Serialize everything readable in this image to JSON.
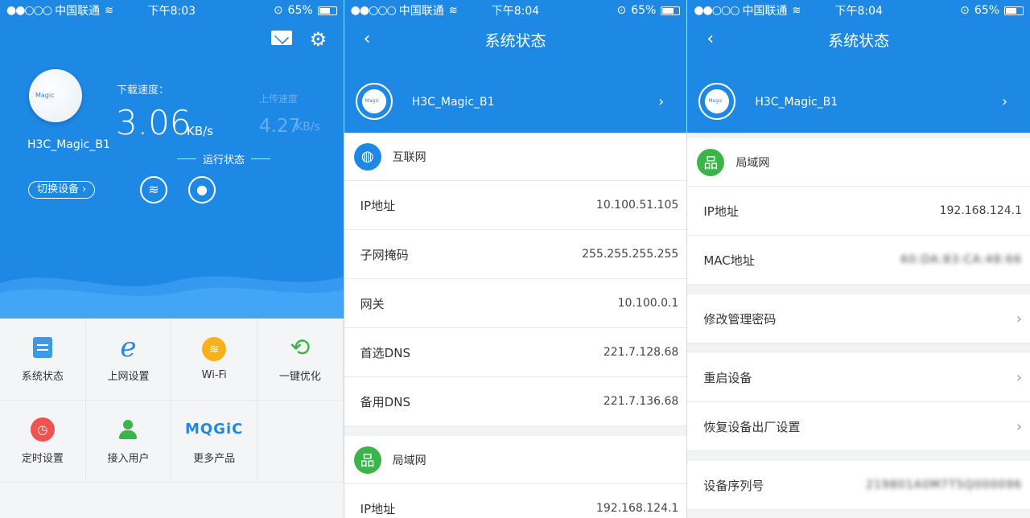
{
  "status_bar": [
    {
      "signal": "●●○○○",
      "carrier": "中国联通",
      "wifi": "≋",
      "time": "下午8:03",
      "lock": "⊙",
      "battery": "65%"
    },
    {
      "signal": "●●○○○",
      "carrier": "中国联通",
      "wifi": "≋",
      "time": "下午8:04",
      "lock": "⊙",
      "battery": "65%"
    },
    {
      "signal": "●●○○○",
      "carrier": "中国联通",
      "wifi": "≋",
      "time": "下午8:04",
      "lock": "⊙",
      "battery": "65%"
    }
  ],
  "home": {
    "logo_text": "Magic",
    "device_name": "H3C_Magic_B1",
    "download_label": "下载速度：",
    "download_value": "3.06",
    "download_unit": "KB/s",
    "upload_label": "上传速度",
    "upload_value": "4.27",
    "upload_unit": "KB/s",
    "run_status": "运行状态",
    "switch_label": "切换设备",
    "switch_chevron": "›",
    "grid": [
      {
        "label": "系统状态",
        "icon": "document-icon"
      },
      {
        "label": "上网设置",
        "icon": "ie-icon",
        "glyph": "e"
      },
      {
        "label": "Wi-Fi",
        "icon": "wifi-icon",
        "glyph": "≋"
      },
      {
        "label": "一键优化",
        "icon": "refresh-icon",
        "glyph": "⟲"
      },
      {
        "label": "定时设置",
        "icon": "alarm-icon",
        "glyph": "◷"
      },
      {
        "label": "接入用户",
        "icon": "user-icon"
      },
      {
        "label": "更多产品",
        "icon": "magic-logo-icon",
        "glyph": "MQGiC"
      }
    ]
  },
  "status_page": {
    "back": "‹",
    "title": "系统状态",
    "device_logo": "Magic",
    "device_name": "H3C_Magic_B1",
    "device_chevron": "›",
    "internet": {
      "heading": "互联网",
      "rows": [
        {
          "label": "IP地址",
          "value": "10.100.51.105"
        },
        {
          "label": "子网掩码",
          "value": "255.255.255.255"
        },
        {
          "label": "网关",
          "value": "10.100.0.1"
        },
        {
          "label": "首选DNS",
          "value": "221.7.128.68"
        },
        {
          "label": "备用DNS",
          "value": "221.7.136.68"
        }
      ]
    },
    "lan": {
      "heading": "局域网",
      "rows": [
        {
          "label": "IP地址",
          "value": "192.168.124.1"
        }
      ]
    }
  },
  "status_page_2": {
    "back": "‹",
    "title": "系统状态",
    "device_logo": "Magic",
    "device_name": "H3C_Magic_B1",
    "device_chevron": "›",
    "lan": {
      "heading": "局域网",
      "rows": [
        {
          "label": "IP地址",
          "value": "192.168.124.1"
        },
        {
          "label": "MAC地址",
          "value": "60:DA:83:CA:48:66"
        }
      ]
    },
    "actions": [
      {
        "label": "修改管理密码",
        "chevron": "›"
      },
      {
        "label": "重启设备",
        "chevron": "›"
      },
      {
        "label": "恢复设备出厂设置",
        "chevron": "›"
      }
    ],
    "serial": {
      "label": "设备序列号",
      "value": "219801A0M7T5Q000096"
    }
  }
}
